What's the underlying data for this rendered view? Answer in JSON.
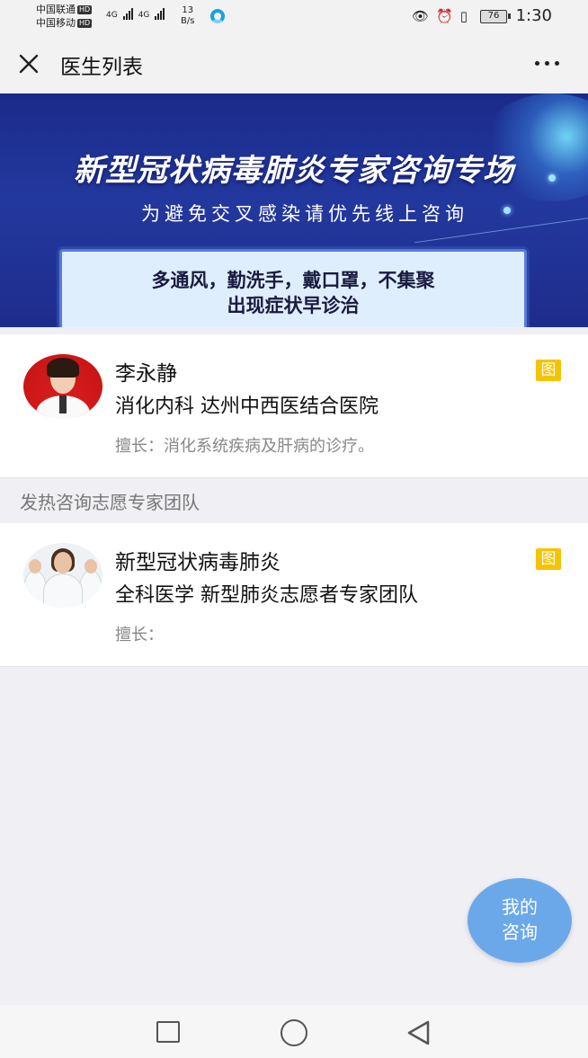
{
  "status_bar": {
    "carrier_1": "中国联通",
    "carrier_2": "中国移动",
    "hd": "HD",
    "network_1": "4G",
    "network_2": "4G",
    "speed_value": "13",
    "speed_unit": "B/s",
    "battery": "76",
    "time": "1:30"
  },
  "nav": {
    "title": "医生列表"
  },
  "banner": {
    "title": "新型冠状病毒肺炎专家咨询专场",
    "subtitle": "为避免交叉感染请优先线上咨询",
    "box_line1": "多通风，勤洗手，戴口罩，不集聚",
    "box_line2": "出现症状早诊治"
  },
  "doctors": [
    {
      "name": "李永静",
      "dept": "消化内科 达州中西医结合医院",
      "skill": "擅长：消化系统疾病及肝病的诊疗。",
      "badge": "图"
    }
  ],
  "section": {
    "title": "发热咨询志愿专家团队"
  },
  "teams": [
    {
      "name": "新型冠状病毒肺炎",
      "dept": "全科医学 新型肺炎志愿者专家团队",
      "skill": "擅长：",
      "badge": "图"
    }
  ],
  "fab": {
    "line1": "我的",
    "line2": "咨询"
  },
  "colors": {
    "accent": "#6ba8ea",
    "badge": "#f7c300",
    "banner": "#1e2c8c"
  }
}
